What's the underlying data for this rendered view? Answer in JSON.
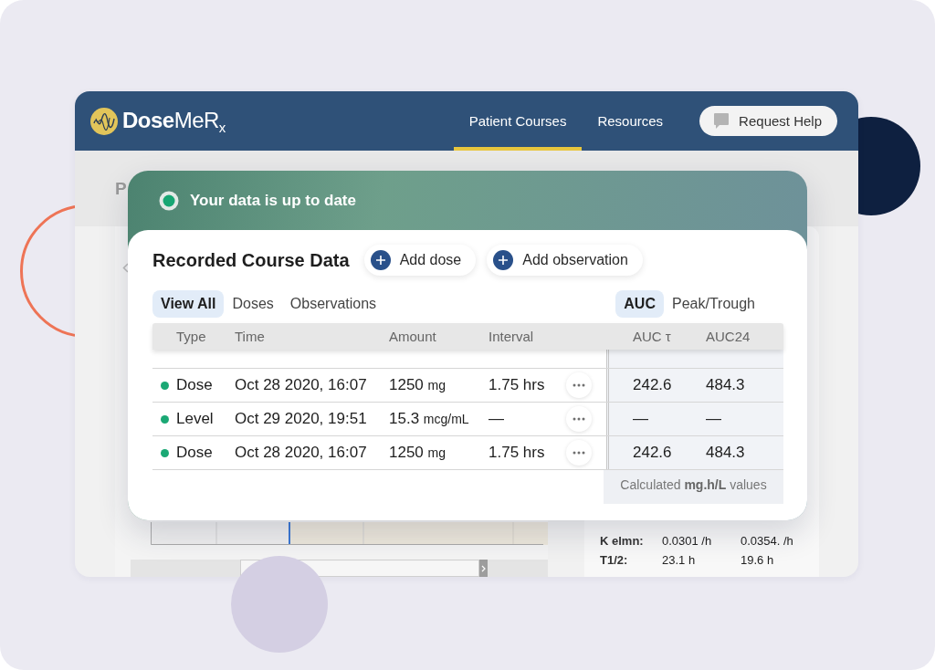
{
  "header": {
    "logo": "**Dose**MeR$_{x}$",
    "nav": [
      {
        "label": "Patient Courses",
        "selected": true
      },
      {
        "label": "Resources",
        "selected": false
      }
    ],
    "help_button": "Request Help"
  },
  "page": {
    "title": "P",
    "summary": [
      {
        "label": "K elmn:",
        "values": [
          "0.0301 /h",
          "0.0354. /h"
        ]
      },
      {
        "label": "T1/2:",
        "values": [
          "23.1 h",
          "19.6 h"
        ]
      }
    ]
  },
  "course_card": {
    "status": {
      "text": "Your data is up to date",
      "up_to_date": true
    },
    "title": "Recorded Course Data",
    "actions": [
      "Add dose",
      "Add observation"
    ],
    "filters": [
      {
        "label": "View All",
        "selected": true
      },
      {
        "label": "Doses",
        "selected": false
      },
      {
        "label": "Observations",
        "selected": false
      }
    ],
    "metrics": [
      {
        "label": "AUC",
        "selected": true
      },
      {
        "label": "Peak/Trough",
        "selected": false
      }
    ],
    "table": {
      "columns": [
        "Type",
        "Time",
        "Amount",
        "Interval",
        "AUC τ",
        "AUC24"
      ],
      "rows": [
        {
          "type": "Dose",
          "color": "#1aa874",
          "time": "Oct 28 2020, 16:07",
          "amount": "1250",
          "unit": "mg",
          "interval": "1.75 hrs",
          "auc_tau": "242.6",
          "auc24": "484.3"
        },
        {
          "type": "Level",
          "color": "#1aa874",
          "time": "Oct 29 2020, 19:51",
          "amount": "15.3",
          "unit": "mcg/mL",
          "interval": "—",
          "auc_tau": "—",
          "auc24": "—"
        },
        {
          "type": "Dose",
          "color": "#1aa874",
          "time": "Oct 28 2020, 16:07",
          "amount": "1250",
          "unit": "mg",
          "interval": "1.75 hrs",
          "auc_tau": "242.6",
          "auc24": "484.3"
        }
      ],
      "footnote": "Calculated **mg.h/L** values"
    }
  }
}
